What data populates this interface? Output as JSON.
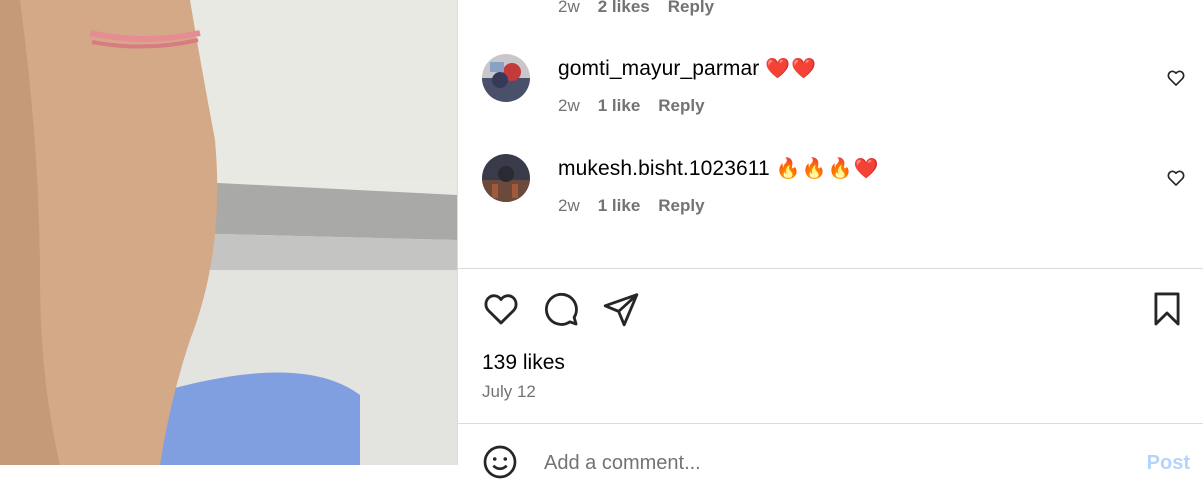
{
  "previous_comment": {
    "time": "2w",
    "likes": "2 likes",
    "reply": "Reply"
  },
  "comments": [
    {
      "username": "gomti_mayur_parmar",
      "emoji": "❤️❤️",
      "time": "2w",
      "likes": "1 like",
      "reply": "Reply"
    },
    {
      "username": "mukesh.bisht.1023611",
      "emoji": "🔥🔥🔥❤️",
      "time": "2w",
      "likes": "1 like",
      "reply": "Reply"
    }
  ],
  "post": {
    "likes": "139 likes",
    "date": "July 12"
  },
  "composer": {
    "placeholder": "Add a comment...",
    "post_label": "Post"
  },
  "icons": {
    "like": "heart-icon",
    "comment": "comment-icon",
    "share": "share-icon",
    "save": "bookmark-icon",
    "emoji": "smiley-icon"
  }
}
